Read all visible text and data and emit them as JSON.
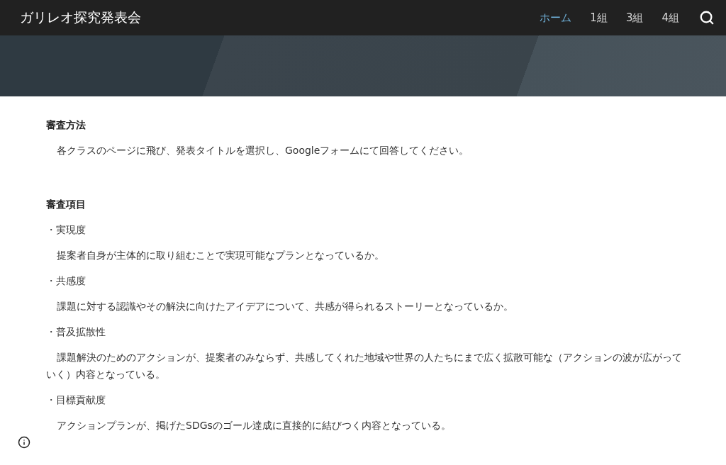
{
  "site_title": "ガリレオ探究発表会",
  "nav": [
    {
      "label": "ホーム",
      "selected": true
    },
    {
      "label": "1組",
      "selected": false
    },
    {
      "label": "3組",
      "selected": false
    },
    {
      "label": "4組",
      "selected": false
    }
  ],
  "sections": [
    {
      "heading": "審査方法",
      "blocks": [
        {
          "kind": "paragraph",
          "text": "各クラスのページに飛び、発表タイトルを選択し、Googleフォームにて回答してください。"
        }
      ]
    },
    {
      "heading": "審査項目",
      "blocks": [
        {
          "kind": "bullet",
          "text": "・実現度"
        },
        {
          "kind": "paragraph",
          "text": "提案者自身が主体的に取り組むことで実現可能なプランとなっているか。"
        },
        {
          "kind": "bullet",
          "text": "・共感度"
        },
        {
          "kind": "paragraph",
          "text": "課題に対する認識やその解決に向けたアイデアについて、共感が得られるストーリーとなっているか。"
        },
        {
          "kind": "bullet",
          "text": "・普及拡散性"
        },
        {
          "kind": "paragraph",
          "text": "課題解決のためのアクションが、提案者のみならず、共感してくれた地域や世界の人たちにまで広く拡散可能な（アクションの波が広がっていく）内容となっている。"
        },
        {
          "kind": "bullet",
          "text": "・目標貢献度"
        },
        {
          "kind": "paragraph",
          "text": "アクションプランが、掲げたSDGsのゴール達成に直接的に結びつく内容となっている。"
        }
      ]
    }
  ]
}
